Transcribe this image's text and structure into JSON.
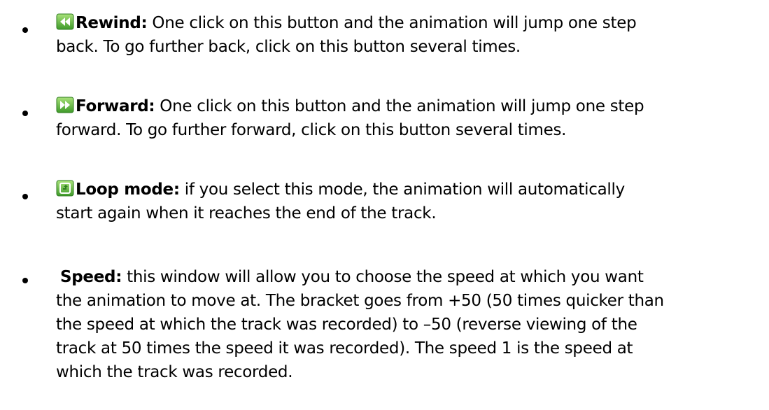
{
  "items": [
    {
      "icon": "rewind-icon",
      "label": "Rewind:",
      "line1": " One click on this button and the animation will jump one step",
      "line2": "back. To go further back, click on this button several times."
    },
    {
      "icon": "forward-icon",
      "label": "Forward:",
      "line1": " One click on this button and the animation will jump one step",
      "line2": "forward. To go further forward, click on this button several times."
    },
    {
      "icon": "loop-icon",
      "label": "Loop mode:",
      "line1": " if you select this mode, the animation will automatically",
      "line2": "start again when it reaches the end of the track."
    },
    {
      "label": "Speed:",
      "line1": " this window will allow you to choose the speed at which you want",
      "line2": "the animation to move at. The bracket goes from +50 (50 times quicker than",
      "line3": "the speed at which the track was recorded) to –50 (reverse viewing of the",
      "line4": "track at 50 times the speed it was recorded). The speed 1 is the speed at",
      "line5": "which the track was recorded."
    }
  ],
  "colors": {
    "icon_green_dark": "#3f9a2a",
    "icon_green_light": "#8fd35a"
  }
}
